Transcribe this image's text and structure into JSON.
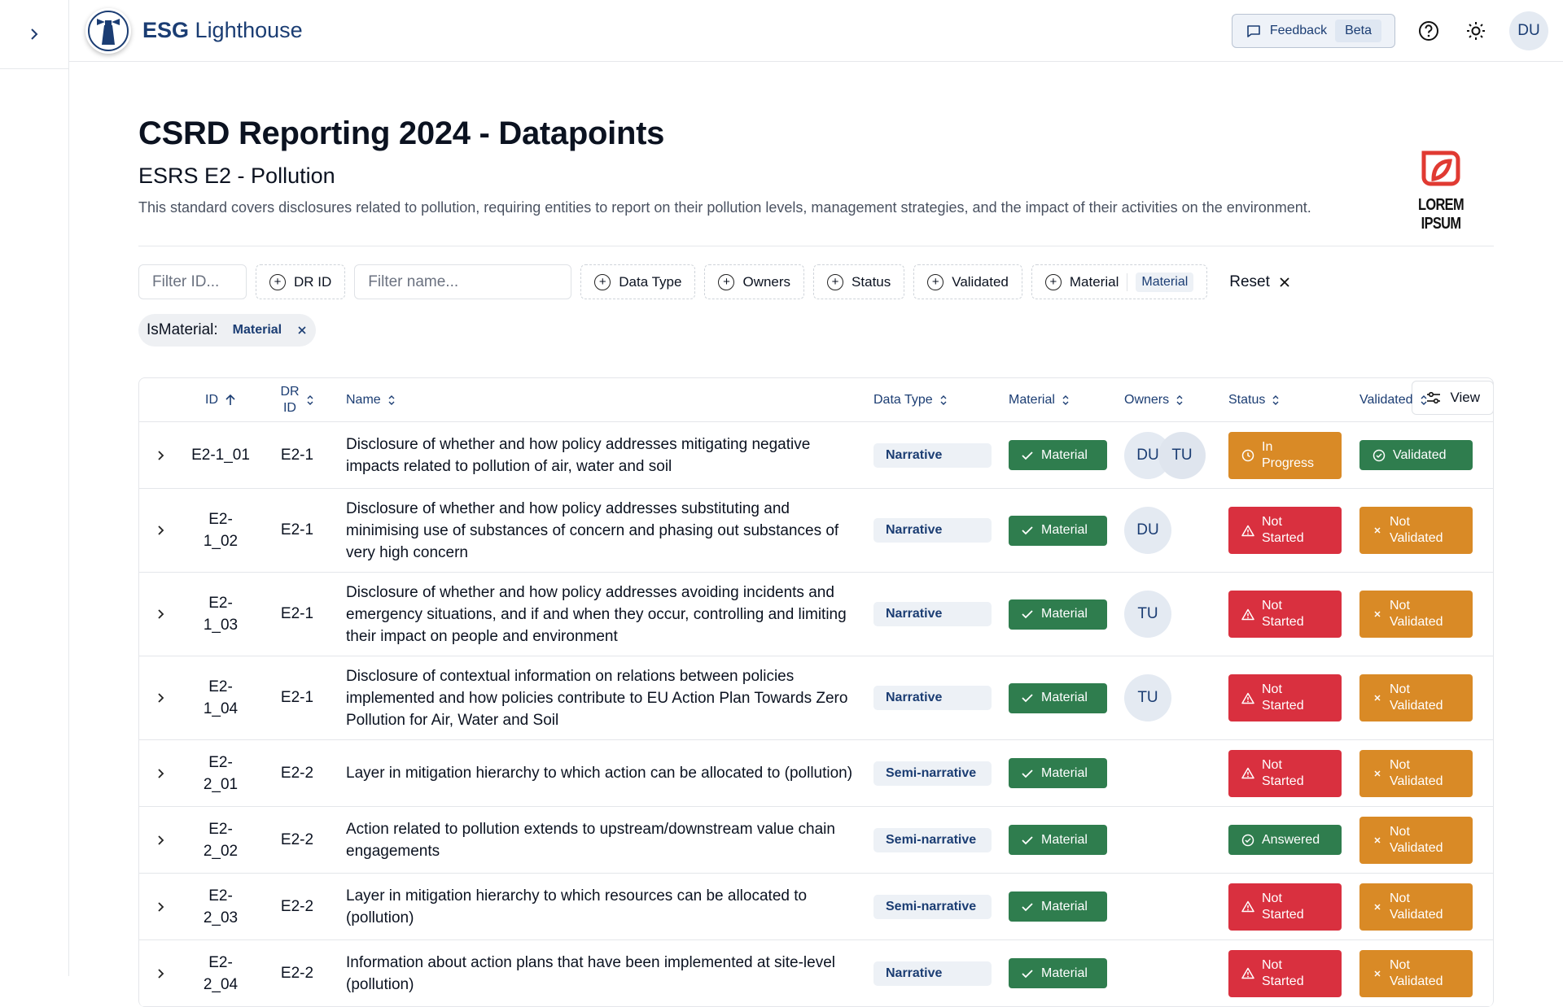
{
  "brand": {
    "bold": "ESG",
    "light": "Lighthouse"
  },
  "topbar": {
    "feedback_label": "Feedback",
    "beta_label": "Beta",
    "user_initials": "DU"
  },
  "page": {
    "title": "CSRD Reporting 2024 - Datapoints",
    "subtitle": "ESRS E2 - Pollution",
    "description": "This standard covers disclosures related to pollution, requiring entities to report on their pollution levels, management strategies, and the impact of their activities on the environment.",
    "corp_logo_text": "LOREM IPSUM"
  },
  "filters": {
    "id_placeholder": "Filter ID...",
    "dr_id": "DR ID",
    "name_placeholder": "Filter name...",
    "data_type": "Data Type",
    "owners": "Owners",
    "status": "Status",
    "validated": "Validated",
    "material": "Material",
    "material_selected": "Material",
    "reset": "Reset",
    "view": "View",
    "active_label": "IsMaterial:",
    "active_value": "Material"
  },
  "table": {
    "headers": {
      "id": "ID",
      "dr_id_1": "DR",
      "dr_id_2": "ID",
      "name": "Name",
      "data_type": "Data Type",
      "material": "Material",
      "owners": "Owners",
      "status": "Status",
      "validated": "Validated"
    },
    "rows": [
      {
        "id": "E2-1_01",
        "dr": "E2-1",
        "name": "Disclosure of whether and how policy addresses mitigating negative impacts related to pollution of air, water and soil",
        "dtype": "Narrative",
        "material": "Material",
        "owners": [
          "DU",
          "TU"
        ],
        "status": "In Progress",
        "status_kind": "orange",
        "validated": "Validated",
        "validated_kind": "green"
      },
      {
        "id": "E2-1_02",
        "dr": "E2-1",
        "name": "Disclosure of whether and how policy addresses substituting and minimising use of substances of concern and phasing out substances of very high concern",
        "dtype": "Narrative",
        "material": "Material",
        "owners": [
          "DU"
        ],
        "status": "Not Started",
        "status_kind": "red",
        "validated": "Not Validated",
        "validated_kind": "orange"
      },
      {
        "id": "E2-1_03",
        "dr": "E2-1",
        "name": "Disclosure of whether and how policy addresses avoiding incidents and emergency situations, and if and when they occur, controlling and limiting their impact on people and environment",
        "dtype": "Narrative",
        "material": "Material",
        "owners": [
          "TU"
        ],
        "status": "Not Started",
        "status_kind": "red",
        "validated": "Not Validated",
        "validated_kind": "orange"
      },
      {
        "id": "E2-1_04",
        "dr": "E2-1",
        "name": "Disclosure of contextual information on relations between policies implemented and how policies contribute to EU Action Plan Towards Zero Pollution for Air, Water and Soil",
        "dtype": "Narrative",
        "material": "Material",
        "owners": [
          "TU"
        ],
        "status": "Not Started",
        "status_kind": "red",
        "validated": "Not Validated",
        "validated_kind": "orange"
      },
      {
        "id": "E2-2_01",
        "dr": "E2-2",
        "name": "Layer in mitigation hierarchy to which action can be allocated to (pollution)",
        "dtype": "Semi-narrative",
        "material": "Material",
        "owners": [],
        "status": "Not Started",
        "status_kind": "red",
        "validated": "Not Validated",
        "validated_kind": "orange"
      },
      {
        "id": "E2-2_02",
        "dr": "E2-2",
        "name": "Action related to pollution extends to upstream/downstream value chain engagements",
        "dtype": "Semi-narrative",
        "material": "Material",
        "owners": [],
        "status": "Answered",
        "status_kind": "green",
        "validated": "Not Validated",
        "validated_kind": "orange"
      },
      {
        "id": "E2-2_03",
        "dr": "E2-2",
        "name": "Layer in mitigation hierarchy to which resources can be allocated to (pollution)",
        "dtype": "Semi-narrative",
        "material": "Material",
        "owners": [],
        "status": "Not Started",
        "status_kind": "red",
        "validated": "Not Validated",
        "validated_kind": "orange"
      },
      {
        "id": "E2-2_04",
        "dr": "E2-2",
        "name": "Information about action plans that have been implemented at site-level (pollution)",
        "dtype": "Narrative",
        "material": "Material",
        "owners": [],
        "status": "Not Started",
        "status_kind": "red",
        "validated": "Not Validated",
        "validated_kind": "orange"
      }
    ]
  },
  "colors": {
    "brand": "#1b3d73",
    "red": "#d9303f",
    "orange": "#d98a26",
    "green": "#2f7d4e"
  }
}
